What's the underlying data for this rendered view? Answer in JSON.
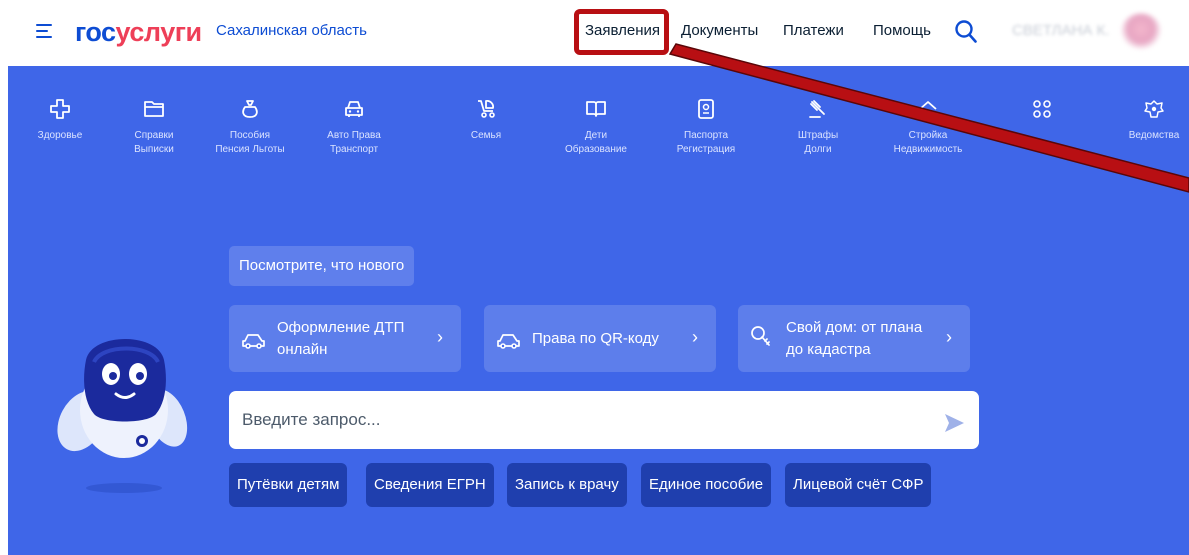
{
  "header": {
    "logo_part1": "гос",
    "logo_part2": "услуги",
    "region": "Сахалинская область",
    "nav": [
      "Заявления",
      "Документы",
      "Платежи",
      "Помощь"
    ],
    "user_name": "СВЕТЛАНА К."
  },
  "categories": [
    {
      "icon": "health-icon",
      "line1": "Здоровье",
      "line2": ""
    },
    {
      "icon": "folder-icon",
      "line1": "Справки",
      "line2": "Выписки"
    },
    {
      "icon": "money-bag-icon",
      "line1": "Пособия",
      "line2": "Пенсия Льготы"
    },
    {
      "icon": "car-icon",
      "line1": "Авто Права",
      "line2": "Транспорт"
    },
    {
      "icon": "stroller-icon",
      "line1": "Семья",
      "line2": ""
    },
    {
      "icon": "book-icon",
      "line1": "Дети",
      "line2": "Образование"
    },
    {
      "icon": "passport-icon",
      "line1": "Паспорта",
      "line2": "Регистрация"
    },
    {
      "icon": "gavel-icon",
      "line1": "Штрафы",
      "line2": "Долги"
    },
    {
      "icon": "house-icon",
      "line1": "Стройка",
      "line2": "Недвижимость"
    },
    {
      "icon": "apps-grid-icon",
      "line1": "",
      "line2": ""
    },
    {
      "icon": "emblem-icon",
      "line1": "Ведомства",
      "line2": ""
    }
  ],
  "whats_new": "Посмотрите, что нового",
  "promos": [
    {
      "icon": "car-icon",
      "line1": "Оформление ДТП",
      "line2": "онлайн"
    },
    {
      "icon": "car-icon",
      "line1": "Права по QR-коду",
      "line2": ""
    },
    {
      "icon": "key-icon",
      "line1": "Свой дом: от плана",
      "line2": "до кадастра"
    }
  ],
  "search": {
    "placeholder": "Введите запрос..."
  },
  "chips": [
    "Путёвки детям",
    "Сведения ЕГРН",
    "Запись к врачу",
    "Единое пособие",
    "Лицевой счёт СФР"
  ],
  "colors": {
    "brand_blue": "#0d4cd3",
    "brand_red": "#ee3f58",
    "panel": "#3f66e8",
    "chip": "#1f3fae",
    "annotation": "#b80f13"
  }
}
